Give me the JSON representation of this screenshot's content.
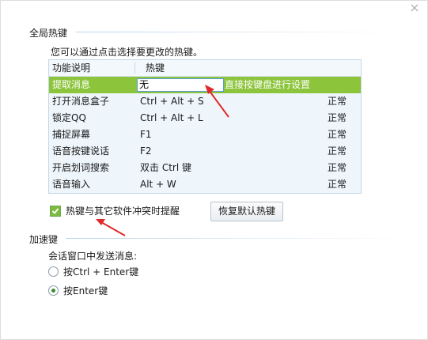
{
  "global_hotkeys": {
    "title": "全局热键",
    "hint": "您可以通过点击选择要更改的热键。",
    "columns": {
      "function": "功能说明",
      "hotkey": "热键"
    },
    "rows": [
      {
        "function": "提取消息",
        "hotkey": "无",
        "status": "",
        "set_hint": "直接按键盘进行设置",
        "selected": true
      },
      {
        "function": "打开消息盒子",
        "hotkey": "Ctrl + Alt + S",
        "status": "正常"
      },
      {
        "function": "锁定QQ",
        "hotkey": "Ctrl + Alt + L",
        "status": "正常"
      },
      {
        "function": "捕捉屏幕",
        "hotkey": "F1",
        "status": "正常"
      },
      {
        "function": "语音按键说话",
        "hotkey": "F2",
        "status": "正常"
      },
      {
        "function": "开启划词搜索",
        "hotkey": "双击 Ctrl 键",
        "status": "正常"
      },
      {
        "function": "语音输入",
        "hotkey": "Alt + W",
        "status": "正常"
      }
    ],
    "conflict_checkbox": {
      "label": "热键与其它软件冲突时提醒",
      "checked": true
    },
    "restore_button": "恢复默认热键"
  },
  "accelerator": {
    "title": "加速键",
    "send_label": "会话窗口中发送消息:",
    "options": [
      {
        "label": "按Ctrl + Enter键",
        "selected": false
      },
      {
        "label": "按Enter键",
        "selected": true
      }
    ]
  },
  "colors": {
    "selected_row": "#8cc43c",
    "arrow": "#e02a2a",
    "table_bg": "#eef6fc"
  },
  "icons": {
    "close": "close-icon",
    "checkbox": "check-icon"
  }
}
